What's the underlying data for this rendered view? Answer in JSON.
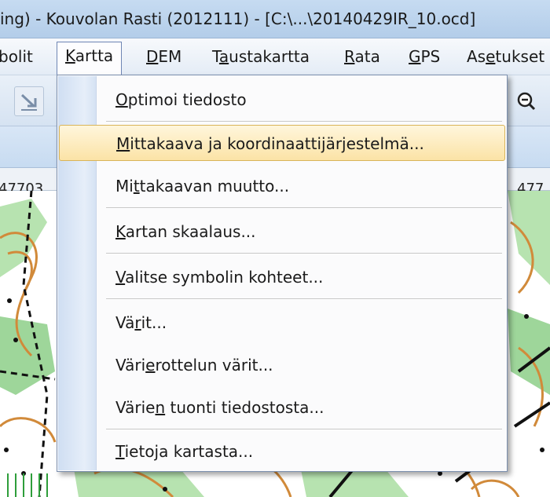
{
  "window": {
    "title": "ing) - Kouvolan Rasti (2012111) - [C:\\...\\20140429IR_10.ocd]"
  },
  "menubar": {
    "items": [
      {
        "pre": "",
        "u": "",
        "post": "bolit"
      },
      {
        "pre": "",
        "u": "K",
        "post": "artta"
      },
      {
        "pre": "",
        "u": "D",
        "post": "EM"
      },
      {
        "pre": "T",
        "u": "a",
        "post": "ustakartta"
      },
      {
        "pre": "",
        "u": "R",
        "post": "ata"
      },
      {
        "pre": "",
        "u": "G",
        "post": "PS"
      },
      {
        "pre": "As",
        "u": "e",
        "post": "tukset"
      }
    ]
  },
  "ruler": {
    "left_value": "47703",
    "right_value": "477"
  },
  "dropdown": {
    "items": [
      {
        "pre": "",
        "u": "O",
        "post": "ptimoi tiedosto"
      },
      {
        "pre": "",
        "u": "M",
        "post": "ittakaava ja koordinaattijärjestelmä..."
      },
      {
        "pre": "Mi",
        "u": "t",
        "post": "takaavan muutto..."
      },
      {
        "pre": "",
        "u": "K",
        "post": "artan skaalaus..."
      },
      {
        "pre": "",
        "u": "V",
        "post": "alitse symbolin kohteet..."
      },
      {
        "pre": "Vä",
        "u": "r",
        "post": "it..."
      },
      {
        "pre": "Väri",
        "u": "e",
        "post": "rottelun värit..."
      },
      {
        "pre": "Värie",
        "u": "n",
        "post": " tuonti tiedostosta..."
      },
      {
        "pre": "",
        "u": "T",
        "post": "ietoja kartasta..."
      }
    ],
    "highlighted_index": 1
  },
  "colors": {
    "highlight": "#fbe3a6",
    "contour": "#d18a3a",
    "vegetation_green": "#9ed69a",
    "map_black": "#111111"
  }
}
